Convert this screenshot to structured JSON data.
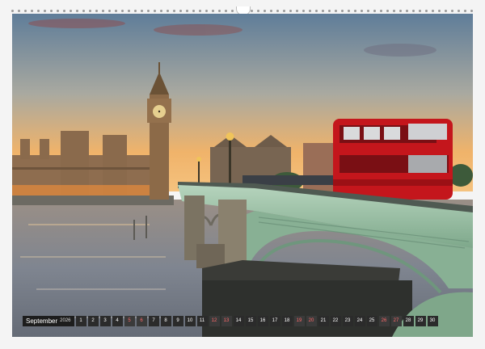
{
  "calendar": {
    "month": "September",
    "year": "2026",
    "days": [
      "1",
      "2",
      "3",
      "4",
      "5",
      "6",
      "7",
      "8",
      "9",
      "10",
      "11",
      "12",
      "13",
      "14",
      "15",
      "16",
      "17",
      "18",
      "19",
      "20",
      "21",
      "22",
      "23",
      "24",
      "25",
      "26",
      "27",
      "28",
      "29",
      "30"
    ],
    "weekend_days": [
      "5",
      "6",
      "12",
      "13",
      "19",
      "20",
      "26",
      "27"
    ]
  },
  "colors": {
    "sky_top": "#6f8aa3",
    "sky_horizon": "#f0b36a",
    "river": "#8a8d95",
    "bridge_green": "#8fb59a",
    "bus_red": "#c4161c",
    "stone": "#8d8472"
  },
  "photo": {
    "subject_icons": [
      "clock-tower",
      "parliament-building",
      "double-decker-bus",
      "arch-bridge",
      "river",
      "street-lamp"
    ]
  }
}
